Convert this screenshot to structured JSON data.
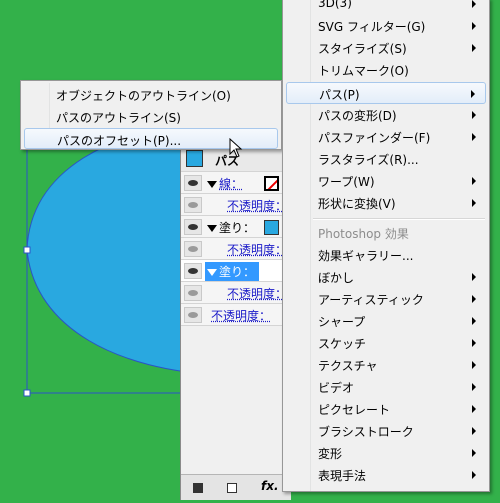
{
  "colors": {
    "background": "#33b14a",
    "shape_fill": "#29a8e0",
    "selection": "#3399ff",
    "menu_bg": "#f0f0f0"
  },
  "submenu": {
    "items": [
      {
        "label": "オブジェクトのアウトライン(O)"
      },
      {
        "label": "パスのアウトライン(S)"
      },
      {
        "label": "パスのオフセット(P)..."
      }
    ],
    "highlighted": 2
  },
  "menu": {
    "items": [
      {
        "label": "3D(3)",
        "submenu": true
      },
      {
        "label": "SVG フィルター(G)",
        "submenu": true
      },
      {
        "label": "スタイライズ(S)",
        "submenu": true
      },
      {
        "label": "トリムマーク(O)",
        "submenu": false
      },
      {
        "label": "パス(P)",
        "submenu": true,
        "highlighted": true
      },
      {
        "label": "パスの変形(D)",
        "submenu": true
      },
      {
        "label": "パスファインダー(F)",
        "submenu": true
      },
      {
        "label": "ラスタライズ(R)...",
        "submenu": false
      },
      {
        "label": "ワープ(W)",
        "submenu": true
      },
      {
        "label": "形状に変換(V)",
        "submenu": true
      },
      {
        "label": "Photoshop 効果",
        "disabled": true
      },
      {
        "label": "効果ギャラリー...",
        "submenu": false
      },
      {
        "label": "ぼかし",
        "submenu": true
      },
      {
        "label": "アーティスティック",
        "submenu": true
      },
      {
        "label": "シャープ",
        "submenu": true
      },
      {
        "label": "スケッチ",
        "submenu": true
      },
      {
        "label": "テクスチャ",
        "submenu": true
      },
      {
        "label": "ビデオ",
        "submenu": true
      },
      {
        "label": "ピクセレート",
        "submenu": true
      },
      {
        "label": "ブラシストローク",
        "submenu": true
      },
      {
        "label": "変形",
        "submenu": true
      },
      {
        "label": "表現手法",
        "submenu": true
      }
    ]
  },
  "panel": {
    "title": "パス",
    "rows": [
      {
        "label": "線：",
        "type": "stroke"
      },
      {
        "label": "不透明度：",
        "type": "opacity"
      },
      {
        "label": "塗り：",
        "type": "fill"
      },
      {
        "label": "不透明度：",
        "type": "opacity"
      },
      {
        "label": "塗り：",
        "type": "fill-selected"
      },
      {
        "label": "不透明度：",
        "type": "opacity"
      },
      {
        "label": "不透明度：",
        "type": "opacity-root"
      }
    ],
    "footer_fx": "fx."
  }
}
